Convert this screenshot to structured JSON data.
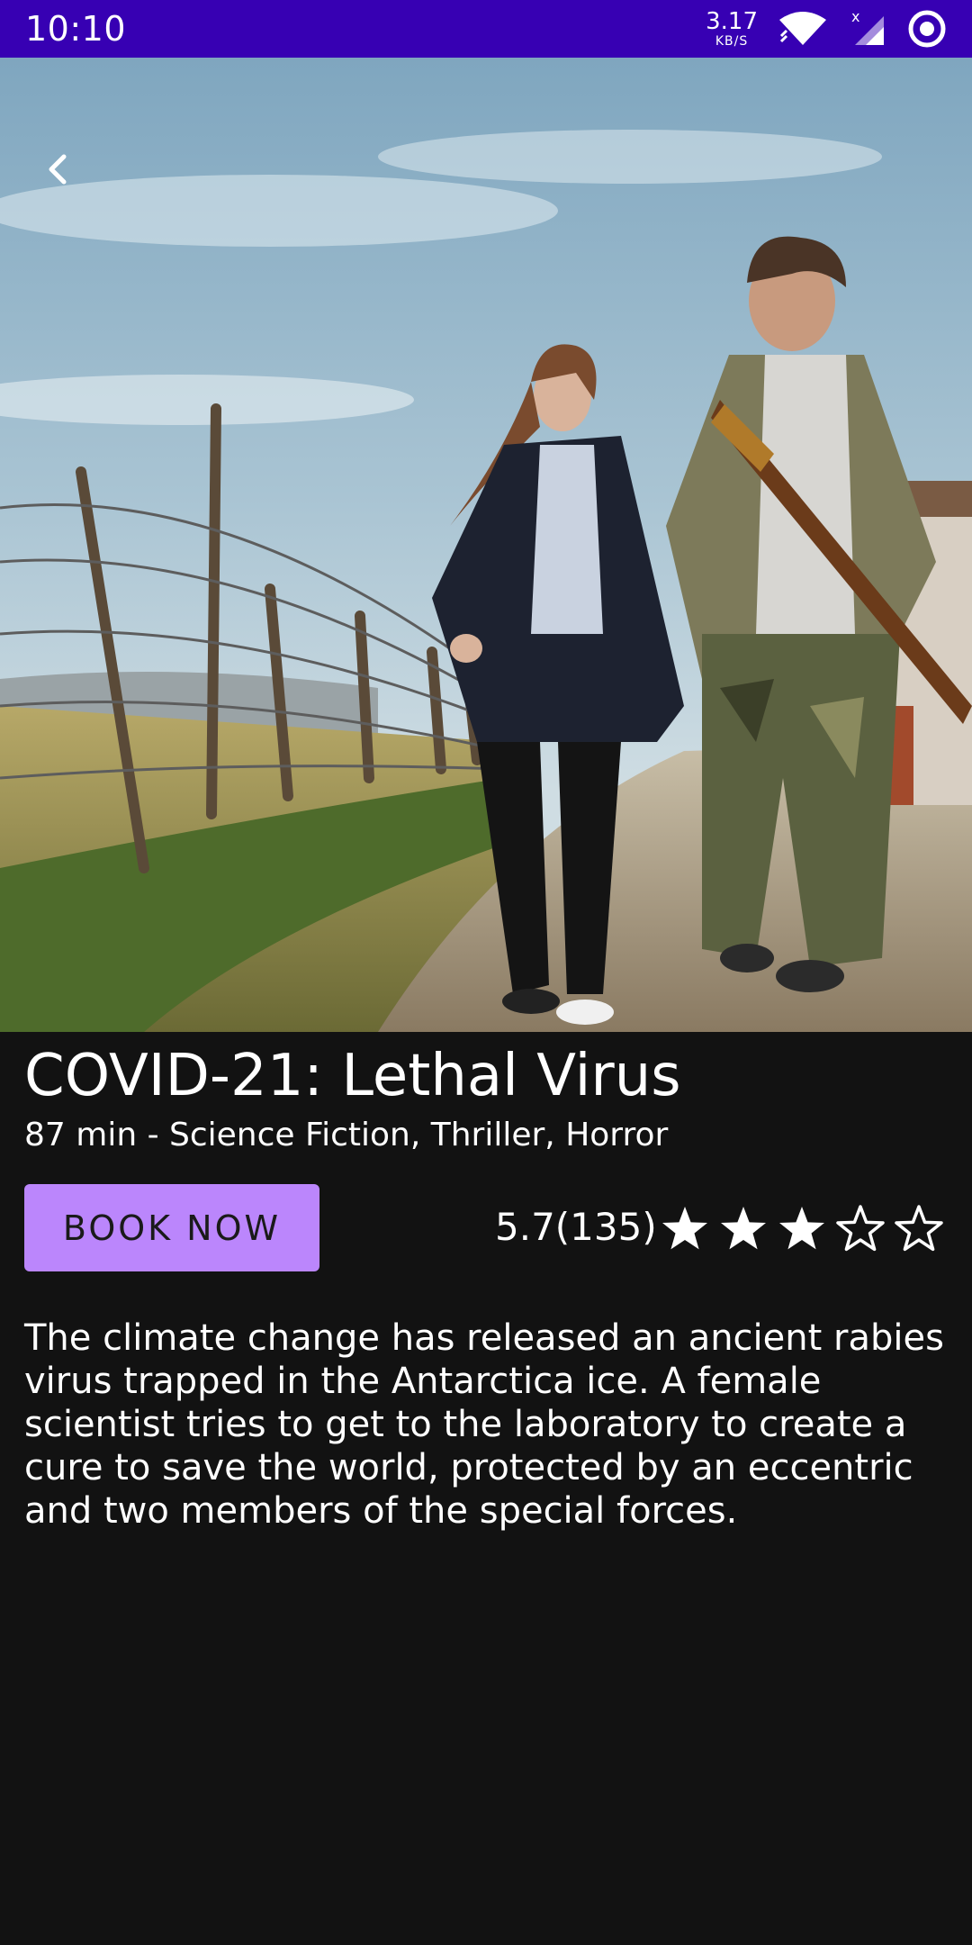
{
  "status_bar": {
    "time": "10:10",
    "net_speed_value": "3.17",
    "net_speed_unit": "KB/S",
    "icons": [
      "wifi-icon",
      "cellular-signal-icon",
      "sync-circle-icon"
    ],
    "background_color": "#3700B3"
  },
  "hero": {
    "back_icon": "chevron-left-icon"
  },
  "movie": {
    "title": "COVID-21: Lethal Virus",
    "meta": "87 min - Science Fiction, Thriller, Horror",
    "book_label": "BOOK NOW",
    "rating_text": "5.7(135)",
    "stars_filled": 3,
    "stars_total": 5,
    "description": "The climate change has released an ancient rabies virus trapped in the Antarctica ice. A female scientist tries to get to the laboratory to create a cure to save the world, protected by an eccentric and two members of the special forces."
  },
  "colors": {
    "accent": "#BB86FC",
    "background": "#121212",
    "text": "#FFFFFF"
  }
}
